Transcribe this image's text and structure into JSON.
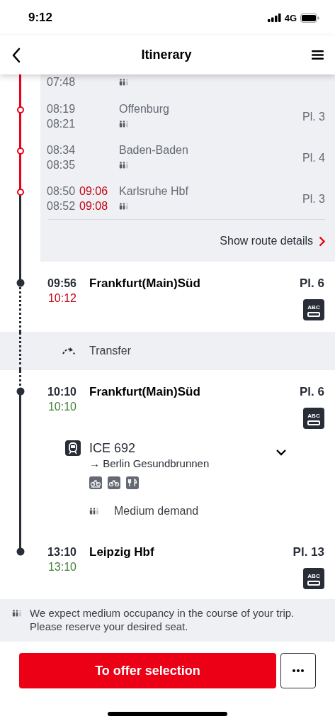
{
  "status_bar": {
    "time": "9:12",
    "network": "4G"
  },
  "header": {
    "title": "Itinerary"
  },
  "intermediate_stops": [
    {
      "planned": [
        "07:48"
      ]
    },
    {
      "planned": [
        "08:19",
        "08:21"
      ],
      "name": "Offenburg",
      "platform": "Pl. 3"
    },
    {
      "planned": [
        "08:34",
        "08:35"
      ],
      "name": "Baden-Baden",
      "platform": "Pl. 4"
    },
    {
      "planned": [
        "08:50",
        "08:52"
      ],
      "actual": [
        "09:06",
        "09:08"
      ],
      "delayed": true,
      "name": "Karlsruhe Hbf",
      "platform": "Pl. 3"
    }
  ],
  "route_details_link": "Show route details",
  "timeline": [
    {
      "kind": "stop",
      "planned": "09:56",
      "actual": "10:12",
      "delayed": true,
      "name": "Frankfurt(Main)Süd",
      "platform": "Pl. 6",
      "wagon_order": "ABC"
    },
    {
      "kind": "transfer",
      "label": "Transfer"
    },
    {
      "kind": "stop",
      "planned": "10:10",
      "actual": "10:10",
      "delayed": false,
      "name": "Frankfurt(Main)Süd",
      "platform": "Pl. 6",
      "wagon_order": "ABC"
    },
    {
      "kind": "train",
      "name": "ICE 692",
      "destination": "→ Berlin Gesundbrunnen",
      "expanded": false,
      "demand": "Medium demand"
    },
    {
      "kind": "stop",
      "planned": "13:10",
      "actual": "13:10",
      "delayed": false,
      "name": "Leipzig Hbf",
      "platform": "Pl. 13",
      "wagon_order": "ABC"
    }
  ],
  "occupancy_notice": "We expect medium occupancy in the course of your trip. Please reserve your desired seat.",
  "actions": {
    "primary": "To offer selection"
  }
}
